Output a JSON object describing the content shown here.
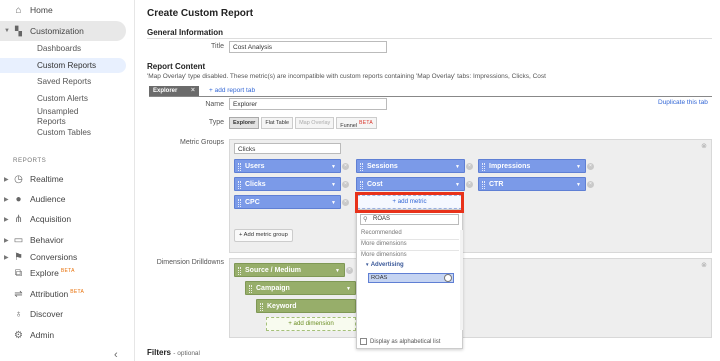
{
  "sidebar": {
    "home": "Home",
    "customization": "Customization",
    "custom_items": [
      "Dashboards",
      "Custom Reports",
      "Saved Reports",
      "Custom Alerts",
      "Unsampled Reports",
      "Custom Tables"
    ],
    "reports_section": "REPORTS",
    "reports": [
      "Realtime",
      "Audience",
      "Acquisition",
      "Behavior",
      "Conversions"
    ],
    "explore": "Explore",
    "attribution": "Attribution",
    "beta": "BETA",
    "discover": "Discover",
    "admin": "Admin",
    "collapse": "‹"
  },
  "page": {
    "title": "Create Custom Report",
    "general_info": "General Information",
    "title_label": "Title",
    "title_value": "Cost Analysis",
    "report_content": "Report Content",
    "warning": "'Map Overlay' type disabled. These metric(s) are incompatible with custom reports containing 'Map Overlay' tabs: Impressions, Clicks, Cost",
    "tab_name": "Explorer",
    "tab_close": "×",
    "add_report_tab": "+ add report tab",
    "duplicate_tab": "Duplicate this tab",
    "name_label": "Name",
    "name_value": "Explorer",
    "type_label": "Type",
    "types": [
      "Explorer",
      "Flat Table",
      "Map Overlay",
      "Funnel"
    ],
    "funnel_beta": "BETA",
    "metric_groups_label": "Metric Groups",
    "metric_group_name": "Clicks",
    "metrics_row1": [
      "Users",
      "Sessions",
      "Impressions"
    ],
    "metrics_row2": [
      "Clicks",
      "Cost",
      "CTR"
    ],
    "metrics_row3": [
      "CPC"
    ],
    "add_metric": "+ add metric",
    "add_metric_group": "+ Add metric group",
    "dimension_drilldowns_label": "Dimension Drilldowns",
    "dimensions": [
      "Source / Medium",
      "Campaign",
      "Keyword"
    ],
    "add_dimension": "+ add dimension",
    "filters_label": "Filters",
    "filters_optional": "- optional"
  },
  "metric_dropdown": {
    "search_value": "ROAS",
    "recommended": "Recommended",
    "more_dimensions_1": "More dimensions",
    "more_dimensions_2": "More dimensions",
    "category": "Advertising",
    "selected_item": "ROAS",
    "alphabetical": "Display as alphabetical list"
  },
  "colors": {
    "metric_blue": "#7b9ae8",
    "dimension_green": "#97ae6a",
    "highlight_red": "#e8321a",
    "link_blue": "#3367d6"
  }
}
